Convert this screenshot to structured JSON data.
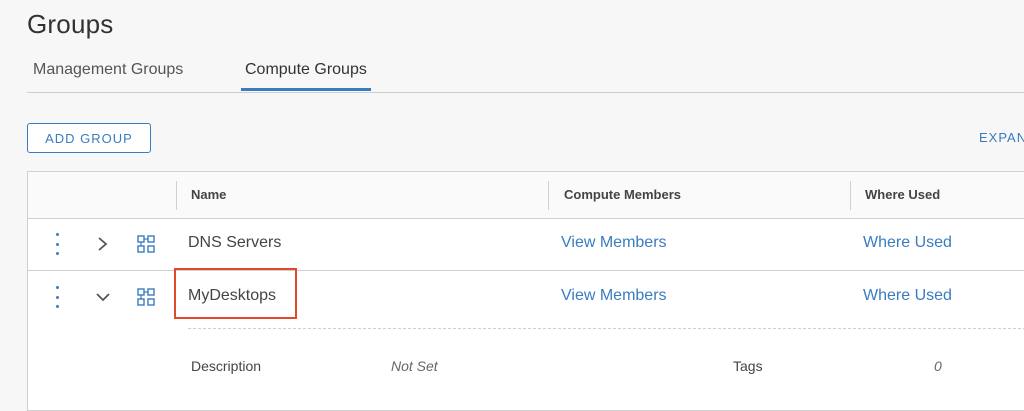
{
  "page": {
    "title": "Groups"
  },
  "tabs": [
    {
      "label": "Management Groups",
      "active": false
    },
    {
      "label": "Compute Groups",
      "active": true
    }
  ],
  "toolbar": {
    "add_group_label": "ADD GROUP",
    "expand_label": "EXPAND ALL"
  },
  "grid": {
    "columns": [
      "Name",
      "Compute Members",
      "Where Used"
    ],
    "rows": [
      {
        "name": "DNS Servers",
        "members_link": "View Members",
        "where_used_link": "Where Used",
        "expanded": false
      },
      {
        "name": "MyDesktops",
        "members_link": "View Members",
        "where_used_link": "Where Used",
        "expanded": true,
        "highlighted": true,
        "details": {
          "description_label": "Description",
          "description_value": "Not Set",
          "tags_label": "Tags",
          "tags_value": "0"
        }
      }
    ]
  },
  "icons": {
    "row_actions": "kebab-menu-icon",
    "collapsed": "chevron-right-icon",
    "expanded": "chevron-down-icon",
    "group": "group-icon"
  },
  "colors": {
    "accent": "#3a7cc0",
    "highlight": "#e0492c",
    "background": "#f7f7f7"
  }
}
